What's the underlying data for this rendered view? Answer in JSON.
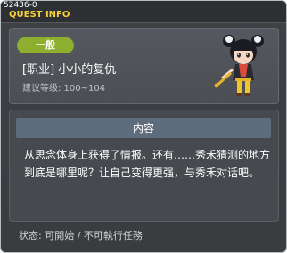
{
  "window": {
    "quest_id": "52436-0",
    "title": "QUEST INFO"
  },
  "info": {
    "badge": "一般",
    "quest_name": "[职业] 小小的复仇",
    "level_text": "建议等级: 100~104"
  },
  "content": {
    "header": "内容",
    "body": "从思念体身上获得了情报。还有……秀禾猜测的地方到底是哪里呢？让自己变得更强，与秀禾对话吧。"
  },
  "status": {
    "text": "状态:  可開始 / 不可執行任務"
  },
  "colors": {
    "title": "#f3cf3d",
    "badge": "#8eae2f",
    "header_bar": "#5d6d7b",
    "panel": "#4b4e53",
    "background": "#3e4045"
  },
  "icons": {
    "npc": "npc-character-portrait"
  }
}
